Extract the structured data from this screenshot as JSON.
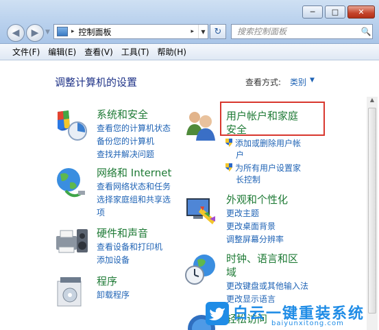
{
  "window": {
    "minimize": "─",
    "maximize": "□",
    "close": "✕"
  },
  "address": {
    "label": "控制面板",
    "sep": "▸"
  },
  "search": {
    "placeholder": "搜索控制面板"
  },
  "menu": [
    "文件(F)",
    "编辑(E)",
    "查看(V)",
    "工具(T)",
    "帮助(H)"
  ],
  "content": {
    "title": "调整计算机的设置",
    "view_by_label": "查看方式:",
    "view_by_value": "类别"
  },
  "categories": [
    {
      "title": "系统和安全",
      "icon": "system-security-icon",
      "links": [
        "查看您的计算机状态",
        "备份您的计算机",
        "查找并解决问题"
      ]
    },
    {
      "title": "网络和 Internet",
      "icon": "network-icon",
      "links": [
        "查看网络状态和任务",
        "选择家庭组和共享选",
        "项"
      ]
    },
    {
      "title": "硬件和声音",
      "icon": "hardware-sound-icon",
      "links": [
        "查看设备和打印机",
        "添加设备"
      ]
    },
    {
      "title": "程序",
      "icon": "programs-icon",
      "links": [
        "卸载程序"
      ]
    },
    {
      "title_line1": "用户帐户和家庭",
      "title_line2": "安全",
      "icon": "user-accounts-icon",
      "links": [
        "添加或删除用户帐",
        "户",
        "为所有用户设置家",
        "长控制"
      ]
    },
    {
      "title": "外观和个性化",
      "icon": "appearance-icon",
      "links": [
        "更改主题",
        "更改桌面背景",
        "调整屏幕分辨率"
      ]
    },
    {
      "title_line1": "时钟、语言和区",
      "title_line2": "域",
      "icon": "clock-language-icon",
      "links": [
        "更改键盘或其他输入法",
        "更改显示语言"
      ]
    },
    {
      "title": "轻松访问",
      "icon": "ease-of-access-icon"
    }
  ],
  "watermark": {
    "text": "白云一键重装系统",
    "url": "baiyunxitong.com"
  },
  "colors": {
    "category_title": "#1e7a35",
    "link": "#1f63b5",
    "highlight_border": "#d8352c",
    "watermark": "#1f8ce6"
  }
}
